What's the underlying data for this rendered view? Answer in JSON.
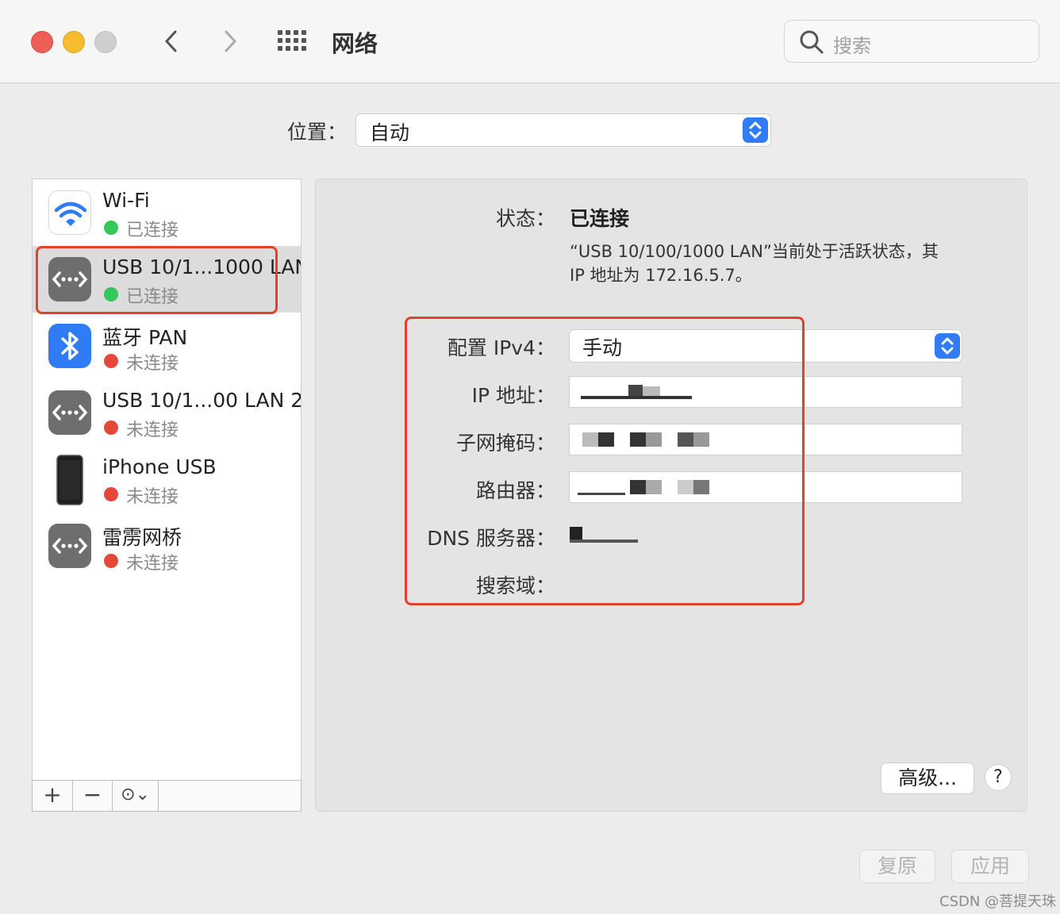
{
  "window": {
    "title": "网络",
    "search_placeholder": "搜索"
  },
  "location": {
    "label": "位置：",
    "value": "自动"
  },
  "services": [
    {
      "name": "Wi-Fi",
      "status": "已连接",
      "status_color": "#34c759",
      "icon": "wifi-icon",
      "selected": false
    },
    {
      "name": "USB 10/1...1000 LAN",
      "status": "已连接",
      "status_color": "#34c759",
      "icon": "ethernet-icon",
      "selected": true
    },
    {
      "name": "蓝牙 PAN",
      "status": "未连接",
      "status_color": "#e5483b",
      "icon": "bluetooth-icon",
      "selected": false
    },
    {
      "name": "USB 10/1...00 LAN 2",
      "status": "未连接",
      "status_color": "#e5483b",
      "icon": "ethernet-icon",
      "selected": false
    },
    {
      "name": "iPhone USB",
      "status": "未连接",
      "status_color": "#e5483b",
      "icon": "iphone-icon",
      "selected": false
    },
    {
      "name": "雷雳网桥",
      "status": "未连接",
      "status_color": "#e5483b",
      "icon": "ethernet-icon",
      "selected": false
    }
  ],
  "sidebar_toolbar": {
    "add": "+",
    "remove": "−",
    "action": "⊙⌄"
  },
  "detail": {
    "status_label": "状态：",
    "status_value": "已连接",
    "status_desc_1": "“USB 10/100/1000 LAN”当前处于活跃状态，其",
    "status_desc_2": "IP 地址为 172.16.5.7。",
    "configure_label": "配置 IPv4：",
    "configure_value": "手动",
    "ip_label": "IP 地址：",
    "subnet_label": "子网掩码：",
    "router_label": "路由器：",
    "dns_label": "DNS 服务器：",
    "search_domain_label": "搜索域："
  },
  "buttons": {
    "advanced": "高级...",
    "help": "?",
    "revert": "复原",
    "apply": "应用"
  },
  "watermark": "CSDN @菩提天珠",
  "colors": {
    "accent": "#2f7cf6",
    "highlight": "#e2412c"
  }
}
